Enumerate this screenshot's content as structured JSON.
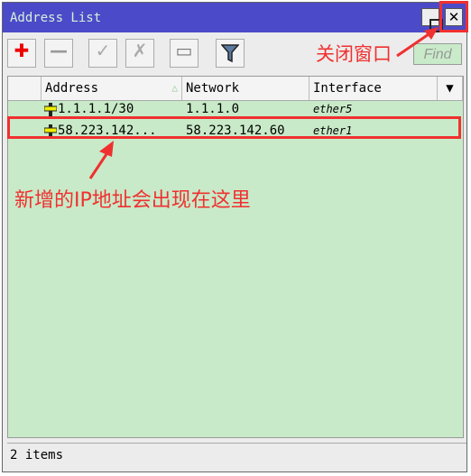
{
  "window": {
    "title": "Address List",
    "maximize_icon": "□",
    "close_icon": "✕"
  },
  "toolbar": {
    "add": "✚",
    "remove": "—",
    "enable": "✓",
    "disable": "✗",
    "comment": "▭",
    "filter": "filter-icon",
    "find": "Find"
  },
  "table": {
    "columns": [
      "Address",
      "Network",
      "Interface"
    ],
    "rows": [
      {
        "address": "1.1.1.1/30",
        "network": "1.1.1.0",
        "interface": "ether5"
      },
      {
        "address": "58.223.142...",
        "network": "58.223.142.60",
        "interface": "ether1"
      }
    ]
  },
  "status": "2 items",
  "annotations": {
    "close_window": "关闭窗口",
    "new_ip": "新增的IP地址会出现在这里"
  },
  "colors": {
    "title_bar": "#4b4bc9",
    "list_bg": "#c8eac8",
    "annotation": "#f03030"
  }
}
